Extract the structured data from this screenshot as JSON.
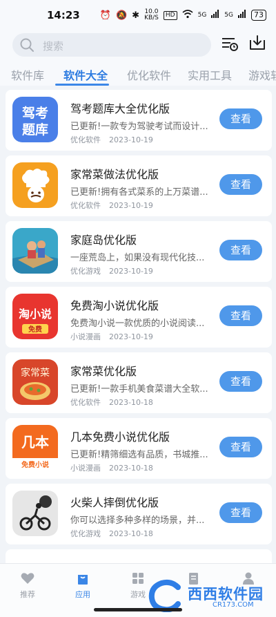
{
  "status": {
    "time": "14:23",
    "speed_value": "10.0",
    "speed_unit": "KB/S",
    "hd": "HD",
    "net1": "5G",
    "net2": "5G",
    "battery": "73"
  },
  "search": {
    "placeholder": "搜索"
  },
  "tabs": [
    "软件库",
    "软件大全",
    "优化软件",
    "实用工具",
    "游戏软"
  ],
  "apps": [
    {
      "title": "驾考题库大全优化版",
      "desc": "已更新!一款专为驾驶考试而设计...",
      "category": "优化软件",
      "date": "2023-10-19",
      "btn": "查看",
      "icon": "jiakao-icon"
    },
    {
      "title": "家常菜做法优化版",
      "desc": "已更新!拥有各式菜系的上万菜谱...",
      "category": "优化软件",
      "date": "2023-10-19",
      "btn": "查看",
      "icon": "chef-icon"
    },
    {
      "title": "家庭岛优化版",
      "desc": "一座荒岛上，如果没有现代化技...",
      "category": "优化游戏",
      "date": "2023-10-19",
      "btn": "查看",
      "icon": "island-icon"
    },
    {
      "title": "免费淘小说优化版",
      "desc": "免费淘小说一款优质的小说阅读...",
      "category": "小说漫画",
      "date": "2023-10-19",
      "btn": "查看",
      "icon": "taoxiaoshuo-icon"
    },
    {
      "title": "家常菜优化版",
      "desc": "已更新!一款手机美食菜谱大全软...",
      "category": "优化软件",
      "date": "2023-10-18",
      "btn": "查看",
      "icon": "jiachangcai-icon"
    },
    {
      "title": "几本免费小说优化版",
      "desc": "已更新!精筛细选有品质，书城推...",
      "category": "小说漫画",
      "date": "2023-10-18",
      "btn": "查看",
      "icon": "jiben-icon"
    },
    {
      "title": "火柴人摔倒优化版",
      "desc": "你可以选择多种多样的场景，并...",
      "category": "优化游戏",
      "date": "2023-10-18",
      "btn": "查看",
      "icon": "stickman-icon"
    }
  ],
  "icon_text": {
    "jiakao_line1": "驾考",
    "jiakao_line2": "题库",
    "tao": "淘小说",
    "tao_free": "免费",
    "jcc": "家常菜",
    "jiben": "几本",
    "jiben_sub": "免费小说"
  },
  "bottom_nav": [
    {
      "label": "推荐",
      "icon": "heart-icon"
    },
    {
      "label": "应用",
      "icon": "bag-icon"
    },
    {
      "label": "游戏",
      "icon": "grid-icon"
    },
    {
      "label": "",
      "icon": "book-icon"
    },
    {
      "label": "",
      "icon": "person-icon"
    }
  ],
  "watermark": {
    "name": "西西软件园",
    "url": "CR173.COM"
  },
  "colors": {
    "accent": "#3c87e8",
    "button": "#4f98ea",
    "background": "#f1f4f8"
  }
}
